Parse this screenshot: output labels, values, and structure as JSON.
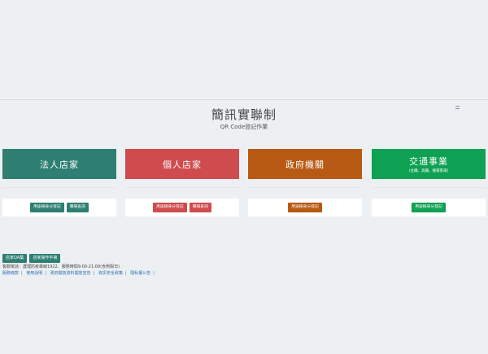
{
  "header": {
    "title": "簡訊實聯制",
    "subtitle": "QR Code登記作業"
  },
  "cards": [
    {
      "title": "法人店家",
      "subtitle": "",
      "color": "#2e7f72",
      "buttons": [
        {
          "label": "用途稱身分登記"
        },
        {
          "label": "職場查詢"
        }
      ]
    },
    {
      "title": "個人店家",
      "subtitle": "",
      "color": "#cf4b4e",
      "buttons": [
        {
          "label": "用途稱身分登記"
        },
        {
          "label": "職場查詢"
        }
      ]
    },
    {
      "title": "政府機關",
      "subtitle": "",
      "color": "#b85a13",
      "buttons": [
        {
          "label": "用途稱身分登記"
        }
      ]
    },
    {
      "title": "交通事業",
      "subtitle": "(台鐵、高鐵、捷運客運)",
      "color": "#0fa153",
      "buttons": [
        {
          "label": "用途稱身分登記"
        }
      ]
    }
  ],
  "bottom_buttons": [
    {
      "label": "店家QA集"
    },
    {
      "label": "店家操作手冊"
    }
  ],
  "contact": "客服電話：護理防疫專線1922、服務時間9:00-21:00(含例假日)",
  "footer_links": [
    {
      "label": "服務條款"
    },
    {
      "label": "使用說明"
    },
    {
      "label": "政府開放資料開放宣告"
    },
    {
      "label": "資訊安全政策"
    },
    {
      "label": "隱私權公告"
    }
  ]
}
